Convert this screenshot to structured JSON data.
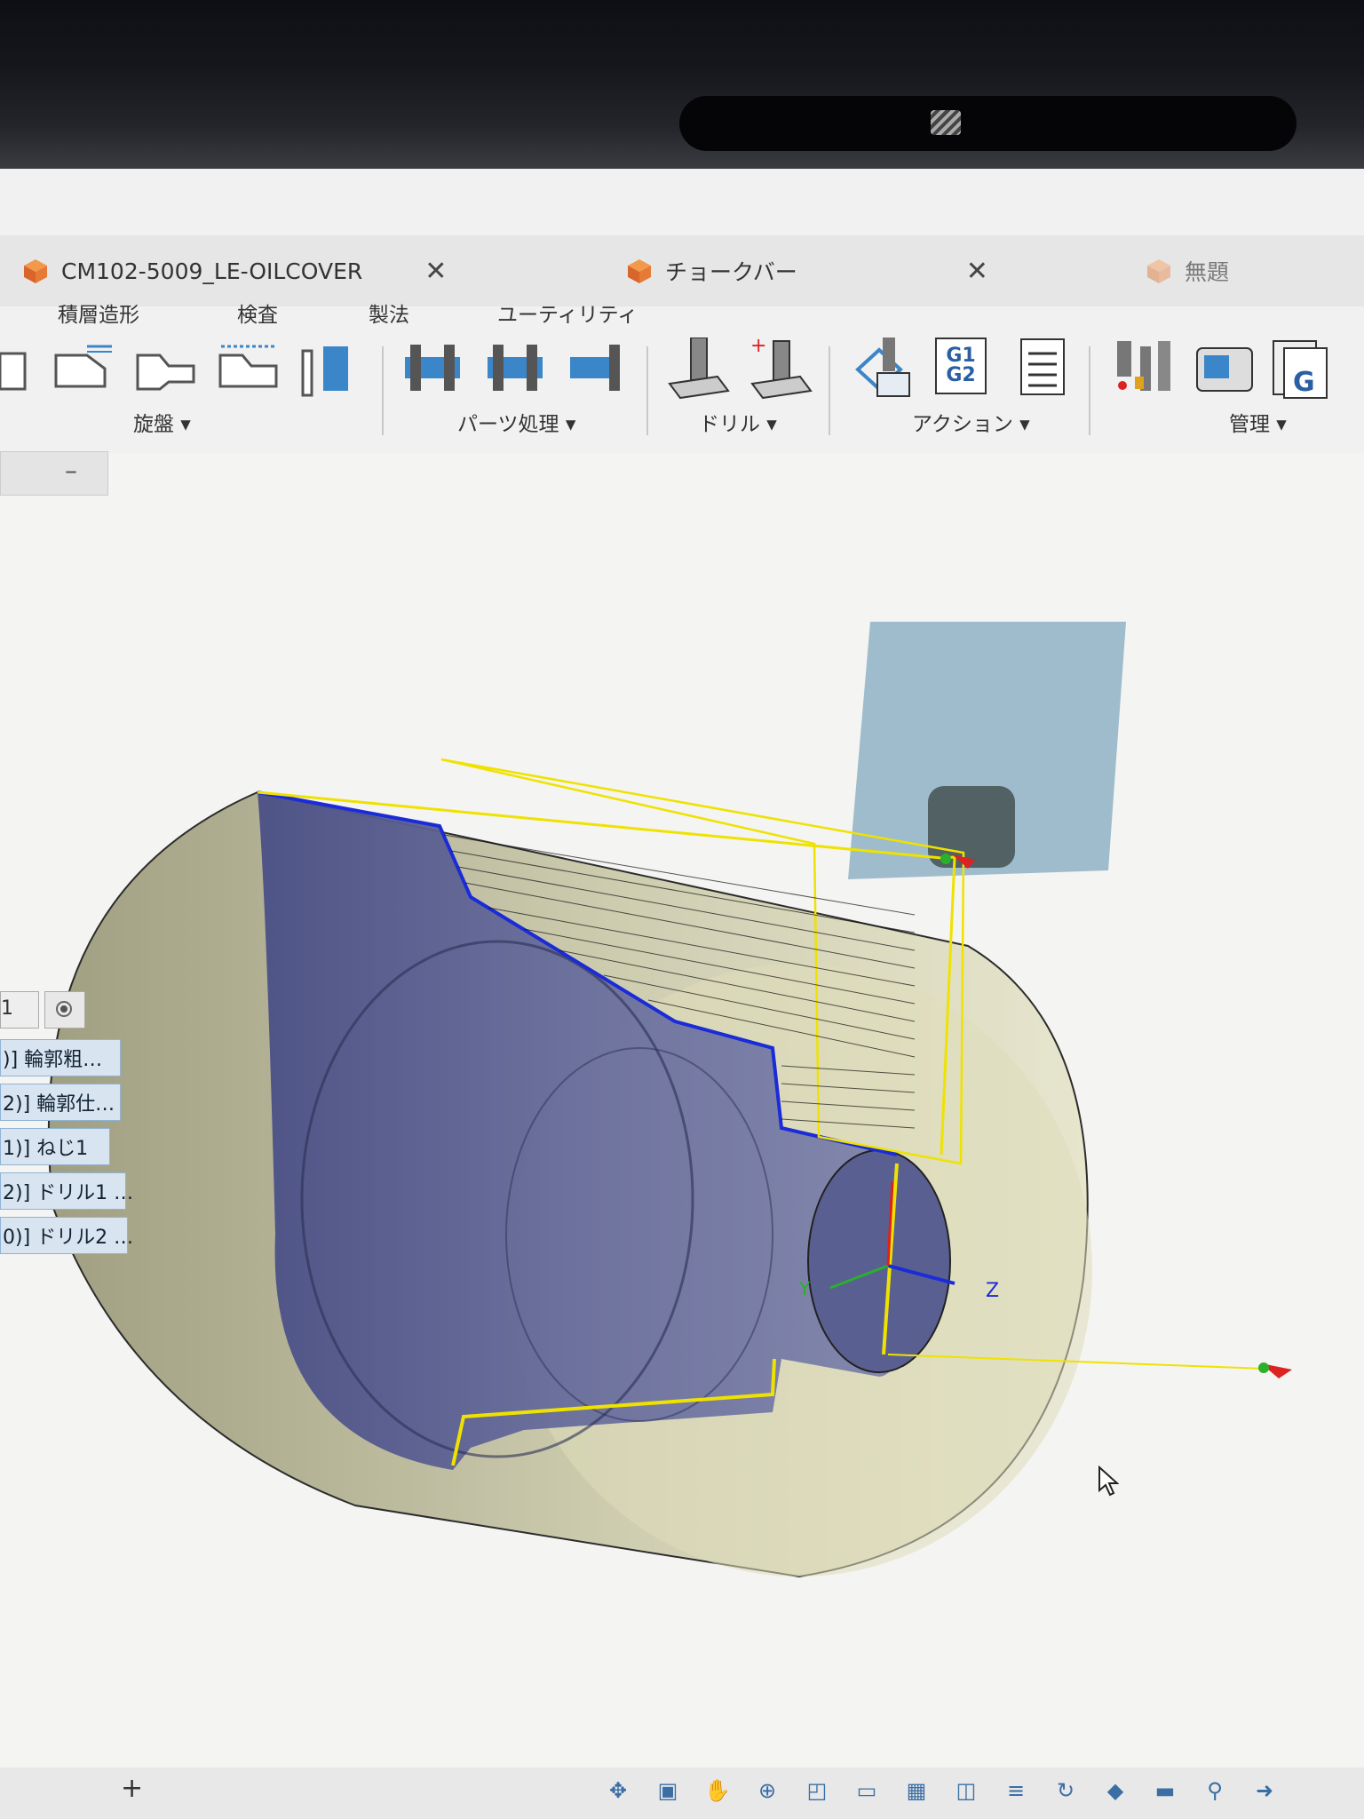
{
  "tabs": [
    {
      "label": "CM102-5009_LE-OILCOVER",
      "close": "✕"
    },
    {
      "label": "チョークバー",
      "close": "✕"
    },
    {
      "label": "無題"
    }
  ],
  "menu": {
    "items": [
      "積層造形",
      "検査",
      "製法",
      "ユーティリティ"
    ]
  },
  "ribbon": {
    "groups": [
      "旋盤 ▾",
      "パーツ処理 ▾",
      "ドリル ▾",
      "アクション ▾",
      "管理 ▾"
    ],
    "g1g2_label": "G1 G2"
  },
  "panel": {
    "collapse_label": "–",
    "head_label": "1"
  },
  "operations": [
    {
      "label": ")] 輪郭粗…"
    },
    {
      "label": "2)] 輪郭仕…"
    },
    {
      "label": "1)] ねじ1"
    },
    {
      "label": "2)] ドリル1 …"
    },
    {
      "label": "0)] ドリル2 …"
    }
  ],
  "axes": {
    "y": "Y",
    "z": "Z"
  },
  "bottom": {
    "add_label": "+"
  },
  "colors": {
    "stock": "#c9c9a6",
    "part": "#6a6f9e",
    "toolpath": "#f0e000",
    "tool_holder": "#8fb1c6"
  },
  "nav_icons": [
    "orbit-icon",
    "look-icon",
    "pan-icon",
    "zoom-icon",
    "fit-icon",
    "display-icon",
    "grid-icon",
    "viewports-icon",
    "layers-icon",
    "refresh-icon",
    "appearance-icon",
    "screen-icon",
    "tool-icon",
    "extra-icon"
  ]
}
